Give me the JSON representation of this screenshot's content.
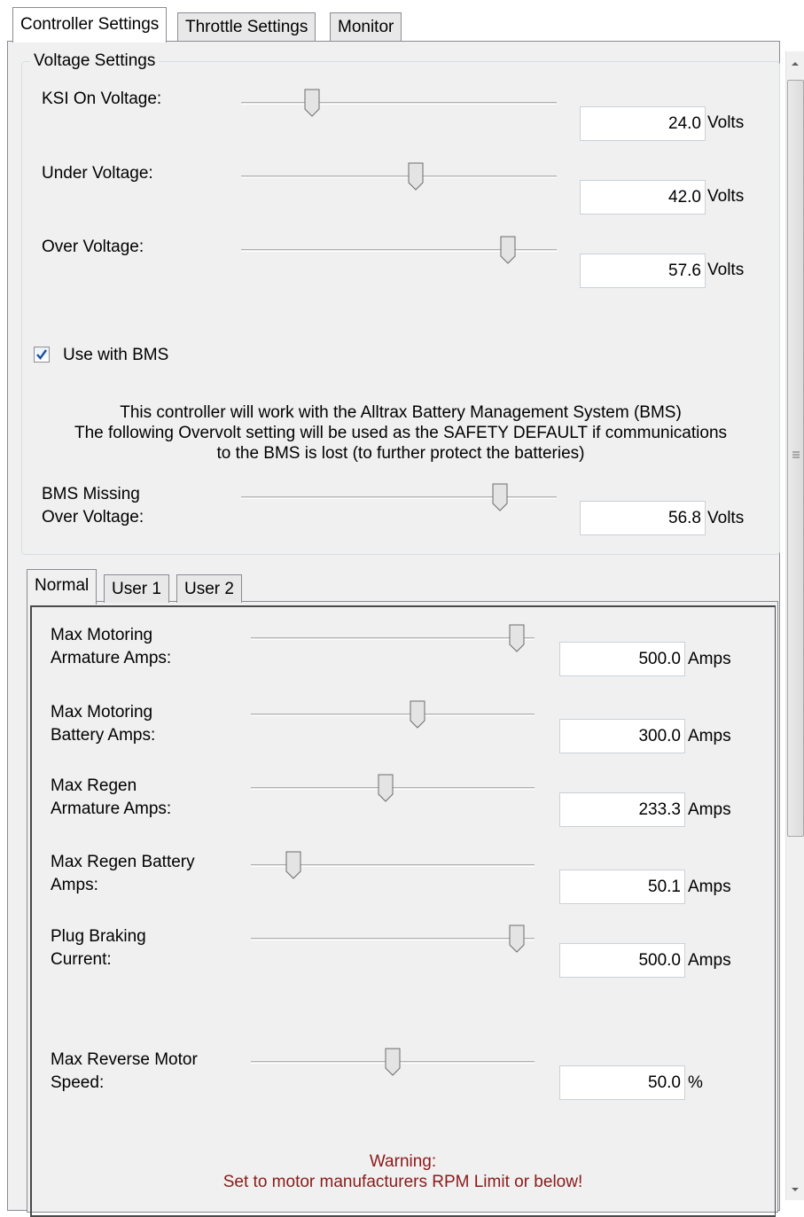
{
  "tabs": [
    "Controller Settings",
    "Throttle Settings",
    "Monitor"
  ],
  "voltage_settings": {
    "title": "Voltage Settings",
    "sliders": [
      {
        "label": "KSI On Voltage:",
        "value": "24.0",
        "unit": "Volts",
        "position": 0.19
      },
      {
        "label": "Under Voltage:",
        "value": "42.0",
        "unit": "Volts",
        "position": 0.56
      },
      {
        "label": "Over Voltage:",
        "value": "57.6",
        "unit": "Volts",
        "position": 0.89
      }
    ],
    "bms_checkbox": {
      "label": "Use with BMS",
      "checked": true
    },
    "bms_description": [
      "This controller will work with the Alltrax Battery Management System (BMS)",
      "The following Overvolt setting will be used as the SAFETY DEFAULT if communications",
      "to the BMS is lost (to further protect the batteries)"
    ],
    "bms_missing": {
      "label_line1": "BMS Missing",
      "label_line2": "Over Voltage:",
      "value": "56.8",
      "unit": "Volts",
      "position": 0.86
    }
  },
  "sub_tabs": [
    "Normal",
    "User 1",
    "User 2"
  ],
  "current_settings": [
    {
      "label_line1": "Max Motoring",
      "label_line2": "Armature Amps:",
      "value": "500.0",
      "unit": "Amps",
      "position": 1.0
    },
    {
      "label_line1": "Max Motoring",
      "label_line2": "Battery Amps:",
      "value": "300.0",
      "unit": "Amps",
      "position": 0.6
    },
    {
      "label_line1": "Max Regen",
      "label_line2": "Armature Amps:",
      "value": "233.3",
      "unit": "Amps",
      "position": 0.47
    },
    {
      "label_line1": "Max Regen Battery",
      "label_line2": "Amps:",
      "value": "50.1",
      "unit": "Amps",
      "position": 0.1
    },
    {
      "label_line1": "Plug Braking",
      "label_line2": "Current:",
      "value": "500.0",
      "unit": "Amps",
      "position": 1.0
    }
  ],
  "reverse_speed": {
    "label_line1": "Max Reverse Motor",
    "label_line2": "Speed:",
    "value": "50.0",
    "unit": "%",
    "position": 0.5
  },
  "warning": {
    "line1": "Warning:",
    "line2": "Set to motor manufacturers RPM Limit or below!"
  },
  "colors": {
    "warning_text": "#8b1a1a",
    "checkbox_check": "#1c4ea1",
    "tab_border": "#898c95"
  }
}
